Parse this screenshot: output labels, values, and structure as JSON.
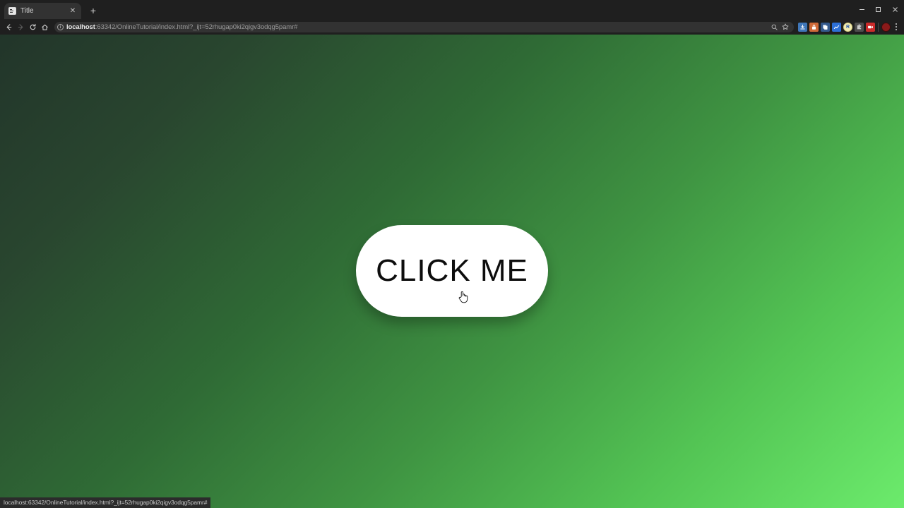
{
  "window": {
    "controls": {
      "minimize_label": "–",
      "maximize_label": "☐",
      "close_label": "✕"
    }
  },
  "tabstrip": {
    "tabs": [
      {
        "title": "Title",
        "favicon_name": "page-favicon",
        "close_label": "✕"
      }
    ],
    "new_tab_label": "+"
  },
  "toolbar": {
    "back_label": "←",
    "forward_label": "→",
    "reload_label": "⟳",
    "home_label": "⌂",
    "security_icon_label": "ⓘ",
    "url": {
      "host": "localhost",
      "rest": ":63342/OnlineTutorial/index.html?_ijt=52rhugap0ki2qigv3odqg5pamr#",
      "full": "localhost:63342/OnlineTutorial/index.html?_ijt=52rhugap0ki2qigv3odqg5pamr#"
    },
    "omni_actions": [
      {
        "name": "zoom-icon",
        "glyph": "⌕"
      },
      {
        "name": "bookmark-star-icon",
        "glyph": "☆"
      }
    ],
    "extensions": [
      {
        "name": "extension-downloads-icon",
        "glyph": "▬",
        "color": "#4a86c8"
      },
      {
        "name": "extension-password-icon",
        "glyph": "▮",
        "color": "#d1683a"
      },
      {
        "name": "extension-clipboard-icon",
        "glyph": "❐",
        "color": "#3e6fa8"
      },
      {
        "name": "extension-chart-icon",
        "glyph": "↗",
        "color": "#2f6fd0"
      },
      {
        "name": "extension-r-icon",
        "glyph": "R",
        "color": "#f0e6a8"
      },
      {
        "name": "extension-puzzle-icon",
        "glyph": "⚙",
        "color": "#5a5a5a"
      },
      {
        "name": "extension-video-icon",
        "glyph": "▶",
        "color": "#d03030"
      }
    ],
    "avatar_name": "profile-avatar",
    "menu_label": "⋮"
  },
  "page": {
    "button_label": "CLICK ME",
    "cursor_name": "hand-cursor",
    "background": {
      "from": "#22352a",
      "to": "#6ceb6c"
    },
    "button_colors": {
      "background": "#ffffff",
      "text": "#0d0d0d"
    }
  },
  "statusbar": {
    "link_url": "localhost:63342/OnlineTutorial/index.html?_ijt=52rhugap0ki2qigv3odqg5pamr#"
  }
}
